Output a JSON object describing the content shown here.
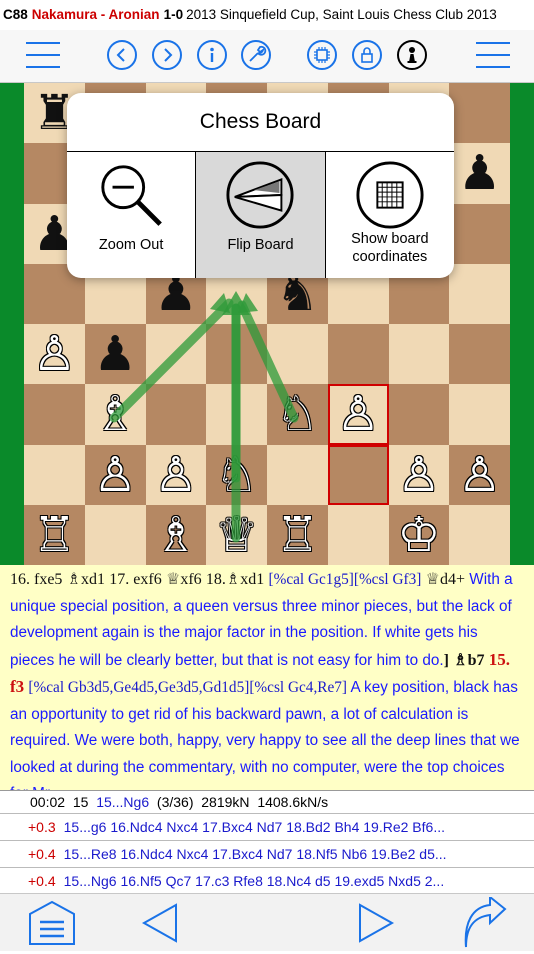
{
  "header": {
    "eco": "C88",
    "players": "Nakamura - Aronian",
    "result": "1-0",
    "event": "2013 Sinquefield Cup, Saint Louis Chess Club 2013"
  },
  "toolbar": {
    "icons": [
      "menu-icon",
      "prev-icon",
      "next-icon",
      "info-icon",
      "wrench-icon",
      "chip-icon",
      "lock-icon",
      "pawn-icon",
      "menu-icon"
    ],
    "accent": "#1a73e8"
  },
  "popover": {
    "title": "Chess Board",
    "items": [
      {
        "label": "Zoom Out",
        "icon": "zoom-out-icon"
      },
      {
        "label": "Flip Board",
        "icon": "flip-board-icon"
      },
      {
        "label_line1": "Show board",
        "label_line2": "coordinates",
        "icon": "grid-icon"
      }
    ]
  },
  "board": {
    "rows": [
      [
        "r",
        "",
        "",
        "",
        "",
        "",
        "",
        ""
      ],
      [
        "",
        "",
        "",
        "",
        "",
        "",
        "",
        "p"
      ],
      [
        "p",
        "",
        "",
        "",
        "",
        "",
        "",
        ""
      ],
      [
        "",
        "",
        "p",
        "",
        "n",
        "",
        "",
        ""
      ],
      [
        "P",
        "p",
        "",
        "",
        "",
        "",
        "",
        ""
      ],
      [
        "",
        "B",
        "",
        "",
        "N",
        "P",
        "",
        ""
      ],
      [
        "",
        "P",
        "P",
        "N",
        "",
        "",
        "P",
        "P"
      ],
      [
        "R",
        "",
        "B",
        "Q",
        "R",
        "",
        "K",
        ""
      ]
    ],
    "highlight": [
      [
        5,
        5
      ],
      [
        6,
        5
      ]
    ]
  },
  "notation": {
    "m1": "16. fxe5",
    "m2": "♗xd1",
    "m3": "17. exf6",
    "m4": "♕xf6",
    "m5": "18.",
    "m6": "♗xd1",
    "c1": "[%cal Gc1g5][%csl Gf3]",
    "m7": "♕d4+",
    "comment1": "With a unique special position, a queen versus three minor pieces, but the lack of development again is the major factor in the position. If white gets his pieces he will be clearly better, but that is not easy for him to do.",
    "bracket": "]",
    "m8": "♗b7",
    "m9": "15. f3",
    "c2": "[%cal Gb3d5,Ge4d5,Ge3d5,Gd1d5][%csl Gc4,Re7]",
    "comment2": "A key position, black has an opportunity to get rid of his backward pawn, a lot of calculation is required. We were both, happy, very happy to see all the deep lines that we looked at during the commentary, with no computer, were the top choices for Mr."
  },
  "engine": {
    "time": "00:02",
    "depth": "15",
    "pv_move": "15...Ng6",
    "progress": "(3/36)",
    "nodes": "2819kN",
    "speed": "1408.6kN/s",
    "lines": [
      {
        "eval": "+0.3",
        "moves": "15...g6 16.Ndc4 Nxc4 17.Bxc4 Nd7 18.Bd2 Bh4 19.Re2 Bf6..."
      },
      {
        "eval": "+0.4",
        "moves": "15...Re8 16.Ndc4 Nxc4 17.Bxc4 Nd7 18.Nf5 Nb6 19.Be2 d5..."
      },
      {
        "eval": "+0.4",
        "moves": "15...Ng6 16.Nf5 Qc7 17.c3 Rfe8 18.Nc4 d5 19.exd5 Nxd5 2..."
      }
    ]
  },
  "bottom": {
    "icons": [
      "list-icon",
      "back-icon",
      "forward-icon",
      "share-icon"
    ]
  }
}
